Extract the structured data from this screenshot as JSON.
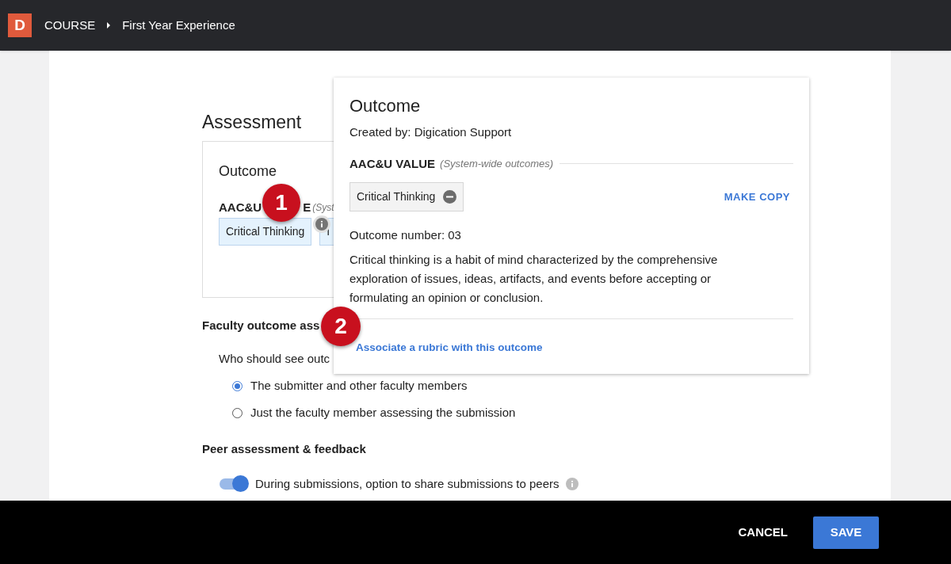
{
  "topbar": {
    "logo": "D",
    "breadcrumb": [
      {
        "label": "COURSE"
      },
      {
        "label": "First Year Experience"
      }
    ]
  },
  "page": {
    "heading": "Assessment",
    "outcome_card": {
      "title": "Outcome",
      "label_start": "AAC&U",
      "label_end": "E",
      "label_note": "(Syst",
      "chips": [
        {
          "label": "Critical Thinking"
        },
        {
          "label": "I"
        }
      ]
    },
    "faculty": {
      "heading": "Faculty outcome ass",
      "question": "Who should see outc",
      "options": [
        {
          "label": "The submitter and other faculty members",
          "selected": true
        },
        {
          "label": "Just the faculty member assessing the submission",
          "selected": false
        }
      ]
    },
    "peer": {
      "heading": "Peer assessment & feedback",
      "toggle": {
        "label": "During submissions, option to share submissions to peers",
        "on": true
      }
    }
  },
  "popover": {
    "title": "Outcome",
    "created_by": "Created by: Digication Support",
    "section": "AAC&U VALUE",
    "section_note": "(System-wide outcomes)",
    "chip": "Critical Thinking",
    "make_copy": "MAKE COPY",
    "number": "Outcome number: 03",
    "description": "Critical thinking is a habit of mind characterized by the comprehensive exploration of issues, ideas, artifacts, and events before accepting or formulating an opinion or conclusion.",
    "link": "Associate a rubric with this outcome"
  },
  "callouts": [
    "1",
    "2"
  ],
  "footer": {
    "cancel": "CANCEL",
    "save": "SAVE"
  }
}
